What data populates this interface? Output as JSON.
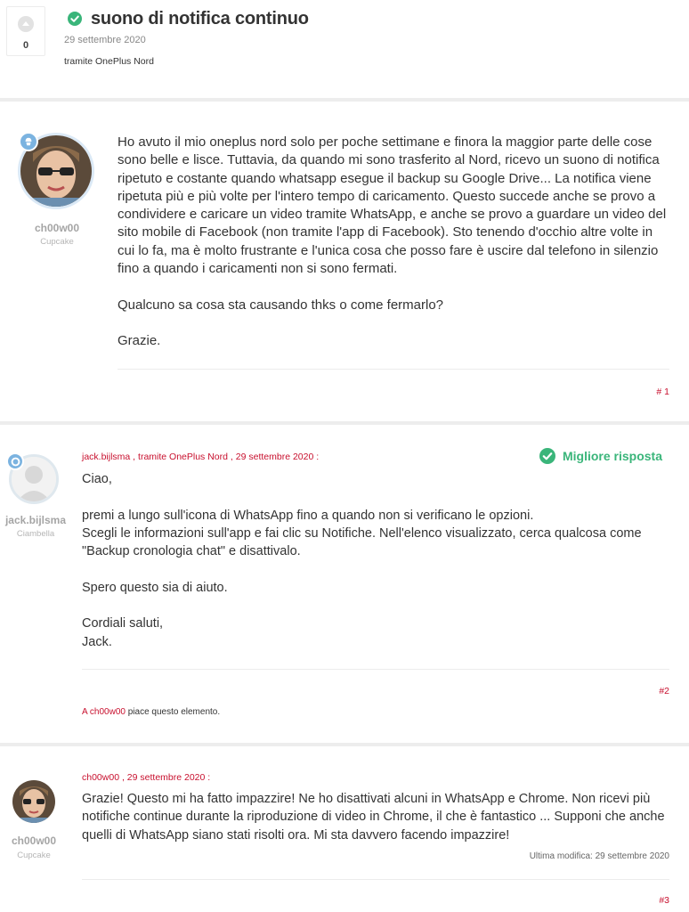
{
  "topic": {
    "vote_count": "0",
    "title": "suono di notifica continuo",
    "date": "29 settembre 2020",
    "via": "tramite OnePlus Nord"
  },
  "posts": [
    {
      "author": "ch00w00",
      "rank": "Cupcake",
      "paragraphs": [
        "Ho avuto il mio oneplus nord solo per poche settimane e finora la maggior parte delle cose sono belle e lisce. Tuttavia, da quando mi sono trasferito al Nord, ricevo un suono di notifica ripetuto e costante quando whatsapp esegue il backup su Google Drive... La notifica viene ripetuta più e più volte per l'intero tempo di caricamento. Questo succede anche se provo a condividere e caricare un video tramite WhatsApp, e anche se provo a guardare un video del sito mobile di Facebook (non tramite l'app di Facebook). Sto tenendo d'occhio altre volte in cui lo fa, ma è molto frustrante e l'unica cosa che posso fare è uscire dal telefono in silenzio fino a quando i caricamenti non si sono fermati.",
        "Qualcuno sa cosa sta causando thks o come fermarlo?",
        "Grazie."
      ],
      "number": "# 1"
    },
    {
      "author": "jack.bijlsma",
      "rank": "Ciambella",
      "meta_user": "jack.bijlsma",
      "meta_via": "tramite OnePlus Nord",
      "meta_date": "29 settembre 2020",
      "best_answer": "Migliore risposta",
      "lines": [
        "Ciao,",
        "",
        "premi a lungo sull'icona di WhatsApp fino a quando non si verificano le opzioni.",
        "Scegli le informazioni sull'app e fai clic su Notifiche. Nell'elenco visualizzato, cerca qualcosa come",
        "\"Backup cronologia chat\" e disattivalo.",
        "",
        "Spero questo sia di aiuto.",
        "",
        "Cordiali saluti,",
        "Jack."
      ],
      "number": "#2",
      "likes_prefix": "A",
      "likes_user": "ch00w00",
      "likes_suffix": "piace questo elemento."
    },
    {
      "author": "ch00w00",
      "rank": "Cupcake",
      "meta_user": "ch00w00",
      "meta_date": "29 settembre 2020",
      "text": "Grazie! Questo mi ha fatto impazzire! Ne ho disattivati alcuni in WhatsApp e Chrome. Non ricevi più notifiche continue durante la riproduzione di video in Chrome, il che è fantastico ... Supponi che anche quelli di WhatsApp siano stati risolti ora. Mi sta davvero facendo impazzire!",
      "edited": "Ultima modifica: 29 settembre 2020",
      "number": "#3"
    }
  ],
  "colors": {
    "accent_red": "#c8102e",
    "success_green": "#3ab57a",
    "rank_blue": "#7bb3e0"
  }
}
